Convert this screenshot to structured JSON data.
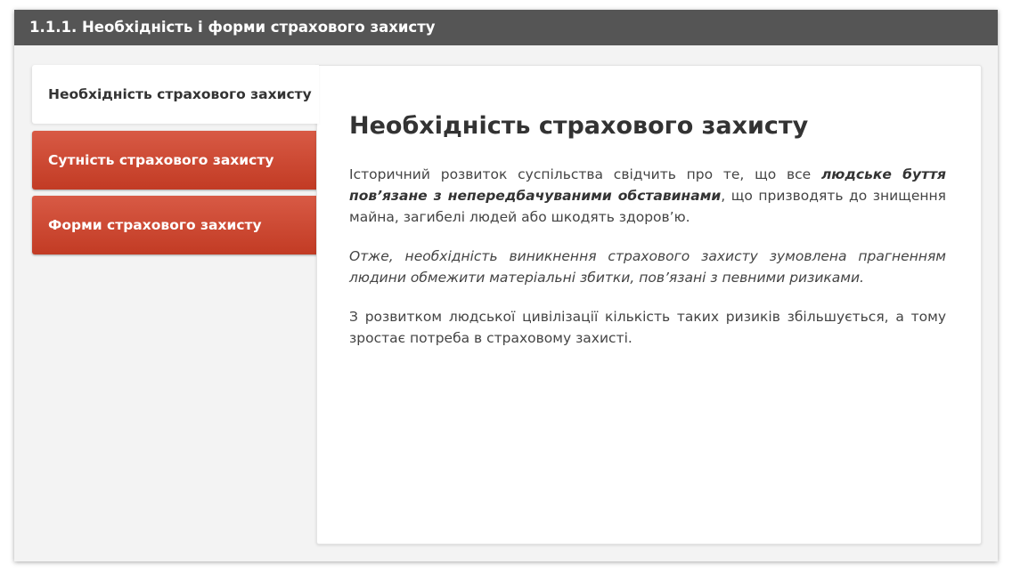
{
  "window": {
    "title": "1.1.1. Необхідність і форми страхового захисту"
  },
  "tabs": [
    {
      "label": "Необхідність страхового захисту",
      "active": true
    },
    {
      "label": "Сутність страхового захисту",
      "active": false
    },
    {
      "label": "Форми страхового захисту",
      "active": false
    }
  ],
  "content": {
    "heading": "Необхідність страхового захисту",
    "p1_text1": "Історичний розвиток суспільства свідчить про те, що все ",
    "p1_emphasis": "людське буття пов’язане з непередбачуваними обставинами",
    "p1_text2": ", що призводять до знищення майна, загибелі людей або шкодять здоров’ю.",
    "p2": "Отже, необхідність виникнення страхового захисту зумовлена прагненням людини обмежити матеріальні збитки, пов’язані з певними ризиками.",
    "p3": "З розвитком людської цивілізації кількість таких ризиків збільшується, а тому зростає потреба в страховому захисті."
  },
  "colors": {
    "title_bar": "#555555",
    "tab_active_bg": "#ffffff",
    "tab_inactive_bg": "#d04a33",
    "tab_inactive_text": "#ffffff"
  }
}
